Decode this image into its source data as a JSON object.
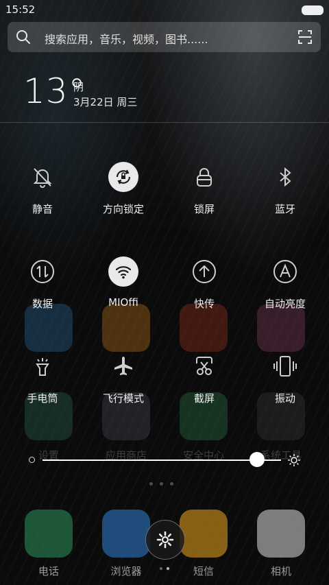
{
  "status_bar": {
    "time": "15:52"
  },
  "search": {
    "placeholder": "搜索应用，音乐，视频，图书......"
  },
  "weather_widget": {
    "temperature": "13°",
    "condition": "阴",
    "date": "3月22日 周三"
  },
  "toggles": [
    {
      "label": "静音",
      "icon": "bell-off-icon",
      "active": false
    },
    {
      "label": "方向锁定",
      "icon": "rotation-lock-icon",
      "active": true
    },
    {
      "label": "锁屏",
      "icon": "lock-icon",
      "active": false
    },
    {
      "label": "蓝牙",
      "icon": "bluetooth-icon",
      "active": false
    },
    {
      "label": "数据",
      "icon": "data-icon",
      "active": false
    },
    {
      "label": "MIOffi",
      "icon": "wifi-icon",
      "active": true
    },
    {
      "label": "快传",
      "icon": "upload-icon",
      "active": false
    },
    {
      "label": "自动亮度",
      "icon": "auto-brightness-icon",
      "active": false
    },
    {
      "label": "手电筒",
      "icon": "flashlight-icon",
      "active": false
    },
    {
      "label": "飞行模式",
      "icon": "airplane-icon",
      "active": false
    },
    {
      "label": "截屏",
      "icon": "screenshot-icon",
      "active": false
    },
    {
      "label": "振动",
      "icon": "vibrate-icon",
      "active": false
    }
  ],
  "brightness": {
    "level": 0.9
  },
  "background_apps": {
    "labels": [
      "设置",
      "应用商店",
      "安全中心",
      "系统工具"
    ]
  },
  "dock": {
    "apps": [
      "电话",
      "浏览器",
      "短信",
      "相机"
    ]
  },
  "colors": {
    "active_toggle": "#e9e9e9",
    "background": "#0d0d0e"
  }
}
